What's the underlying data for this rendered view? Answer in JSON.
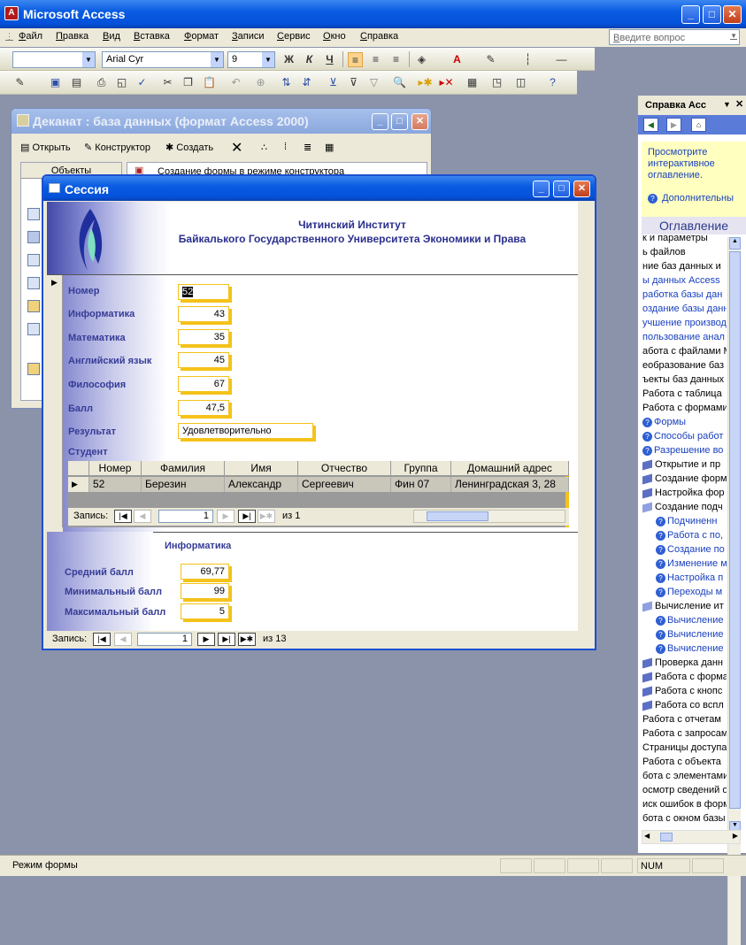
{
  "app": {
    "title": "Microsoft Access"
  },
  "menu": [
    "Файл",
    "Правка",
    "Вид",
    "Вставка",
    "Формат",
    "Записи",
    "Сервис",
    "Окно",
    "Справка"
  ],
  "ask_placeholder": "Введите вопрос",
  "toolbar": {
    "font": "Arial Cyr",
    "size": "9",
    "bold": "Ж",
    "italic": "К",
    "underline": "Ч"
  },
  "dbwindow": {
    "title": "Деканат : база данных (формат Access 2000)",
    "open": "Открыть",
    "design": "Конструктор",
    "create": "Создать",
    "objects": "Объекты",
    "item1": "Создание формы в режиме конструктора"
  },
  "form": {
    "title": "Сессия",
    "header1": "Читинский Институт",
    "header2": "Байкалького Государственного Университета Экономики и Права",
    "fields": [
      {
        "label": "Номер",
        "value": "52"
      },
      {
        "label": "Информатика",
        "value": "43"
      },
      {
        "label": "Математика",
        "value": "35"
      },
      {
        "label": "Английский язык",
        "value": "45"
      },
      {
        "label": "Философия",
        "value": "67"
      },
      {
        "label": "Балл",
        "value": "47,5"
      }
    ],
    "result_label": "Результат",
    "result_value": "Удовлетворительно",
    "student_label": "Студент",
    "sub_cols": [
      "Номер",
      "Фамилия",
      "Имя",
      "Отчество",
      "Группа",
      "Домашний адрес"
    ],
    "sub_row": [
      "52",
      "Березин",
      "Александр",
      "Сергеевич",
      "Фин 07",
      "Ленинградская 3, 28"
    ],
    "sub_nav": {
      "label": "Запись:",
      "current": "1",
      "of": "из",
      "total": "1"
    },
    "footer_title": "Информатика",
    "footer_fields": [
      {
        "label": "Средний балл",
        "value": "69,77"
      },
      {
        "label": "Минимальный балл",
        "value": "99"
      },
      {
        "label": "Максимальный балл",
        "value": "5"
      }
    ],
    "nav": {
      "label": "Запись:",
      "current": "1",
      "of": "из",
      "total": "13"
    }
  },
  "pane": {
    "title": "Справка Acc",
    "box_text1": "Просмотрите",
    "box_text2": "интерактивное",
    "box_text3": "оглавление.",
    "box_link": "Дополнительны",
    "toc_title": "Оглавление",
    "items": [
      {
        "t": "к и параметры",
        "k": "plain"
      },
      {
        "t": "ь файлов",
        "k": "plain"
      },
      {
        "t": "ние баз данных и",
        "k": "plain"
      },
      {
        "t": "ы данных Access",
        "k": "lnk"
      },
      {
        "t": "работка базы дан",
        "k": "lnk"
      },
      {
        "t": "оздание базы данн",
        "k": "lnk"
      },
      {
        "t": "учшение производ",
        "k": "lnk"
      },
      {
        "t": "пользование анал",
        "k": "lnk"
      },
      {
        "t": "абота с файлами Mic",
        "k": "plain"
      },
      {
        "t": "еобразование баз",
        "k": "plain"
      },
      {
        "t": "ъекты баз данных",
        "k": "plain"
      },
      {
        "t": "Работа с таблица",
        "k": "plain"
      },
      {
        "t": "Работа с формами",
        "k": "plain"
      },
      {
        "t": "Формы",
        "k": "q"
      },
      {
        "t": "Способы работ",
        "k": "q"
      },
      {
        "t": "Разрешение во",
        "k": "q"
      },
      {
        "t": "Открытие и пр",
        "k": "b"
      },
      {
        "t": "Создание форм",
        "k": "b"
      },
      {
        "t": "Настройка фор",
        "k": "b"
      },
      {
        "t": "Создание подч",
        "k": "o"
      },
      {
        "t": "Подчиненн",
        "k": "q2"
      },
      {
        "t": "Работа с по,",
        "k": "q2"
      },
      {
        "t": "Создание по",
        "k": "q2"
      },
      {
        "t": "Изменение м",
        "k": "q2"
      },
      {
        "t": "Настройка п",
        "k": "q2"
      },
      {
        "t": "Переходы м",
        "k": "q2"
      },
      {
        "t": "Вычисление ит",
        "k": "o"
      },
      {
        "t": "Вычисление",
        "k": "q2"
      },
      {
        "t": "Вычисление",
        "k": "q2"
      },
      {
        "t": "Вычисление",
        "k": "q2"
      },
      {
        "t": "Проверка данн",
        "k": "b"
      },
      {
        "t": "Работа с форма",
        "k": "b"
      },
      {
        "t": "Работа с кнопс",
        "k": "b"
      },
      {
        "t": "Работа со вспл",
        "k": "b"
      },
      {
        "t": "Работа с отчетам",
        "k": "plain"
      },
      {
        "t": "Работа с запросам",
        "k": "plain"
      },
      {
        "t": "Страницы доступа",
        "k": "plain"
      },
      {
        "t": "Работа с объекта",
        "k": "plain"
      },
      {
        "t": "бота с элементами",
        "k": "plain"
      },
      {
        "t": "осмотр сведений о",
        "k": "plain"
      },
      {
        "t": "иск ошибок в форм",
        "k": "plain"
      },
      {
        "t": "бота с окном базы",
        "k": "plain"
      }
    ]
  },
  "status": {
    "mode": "Режим формы",
    "num": "NUM"
  }
}
